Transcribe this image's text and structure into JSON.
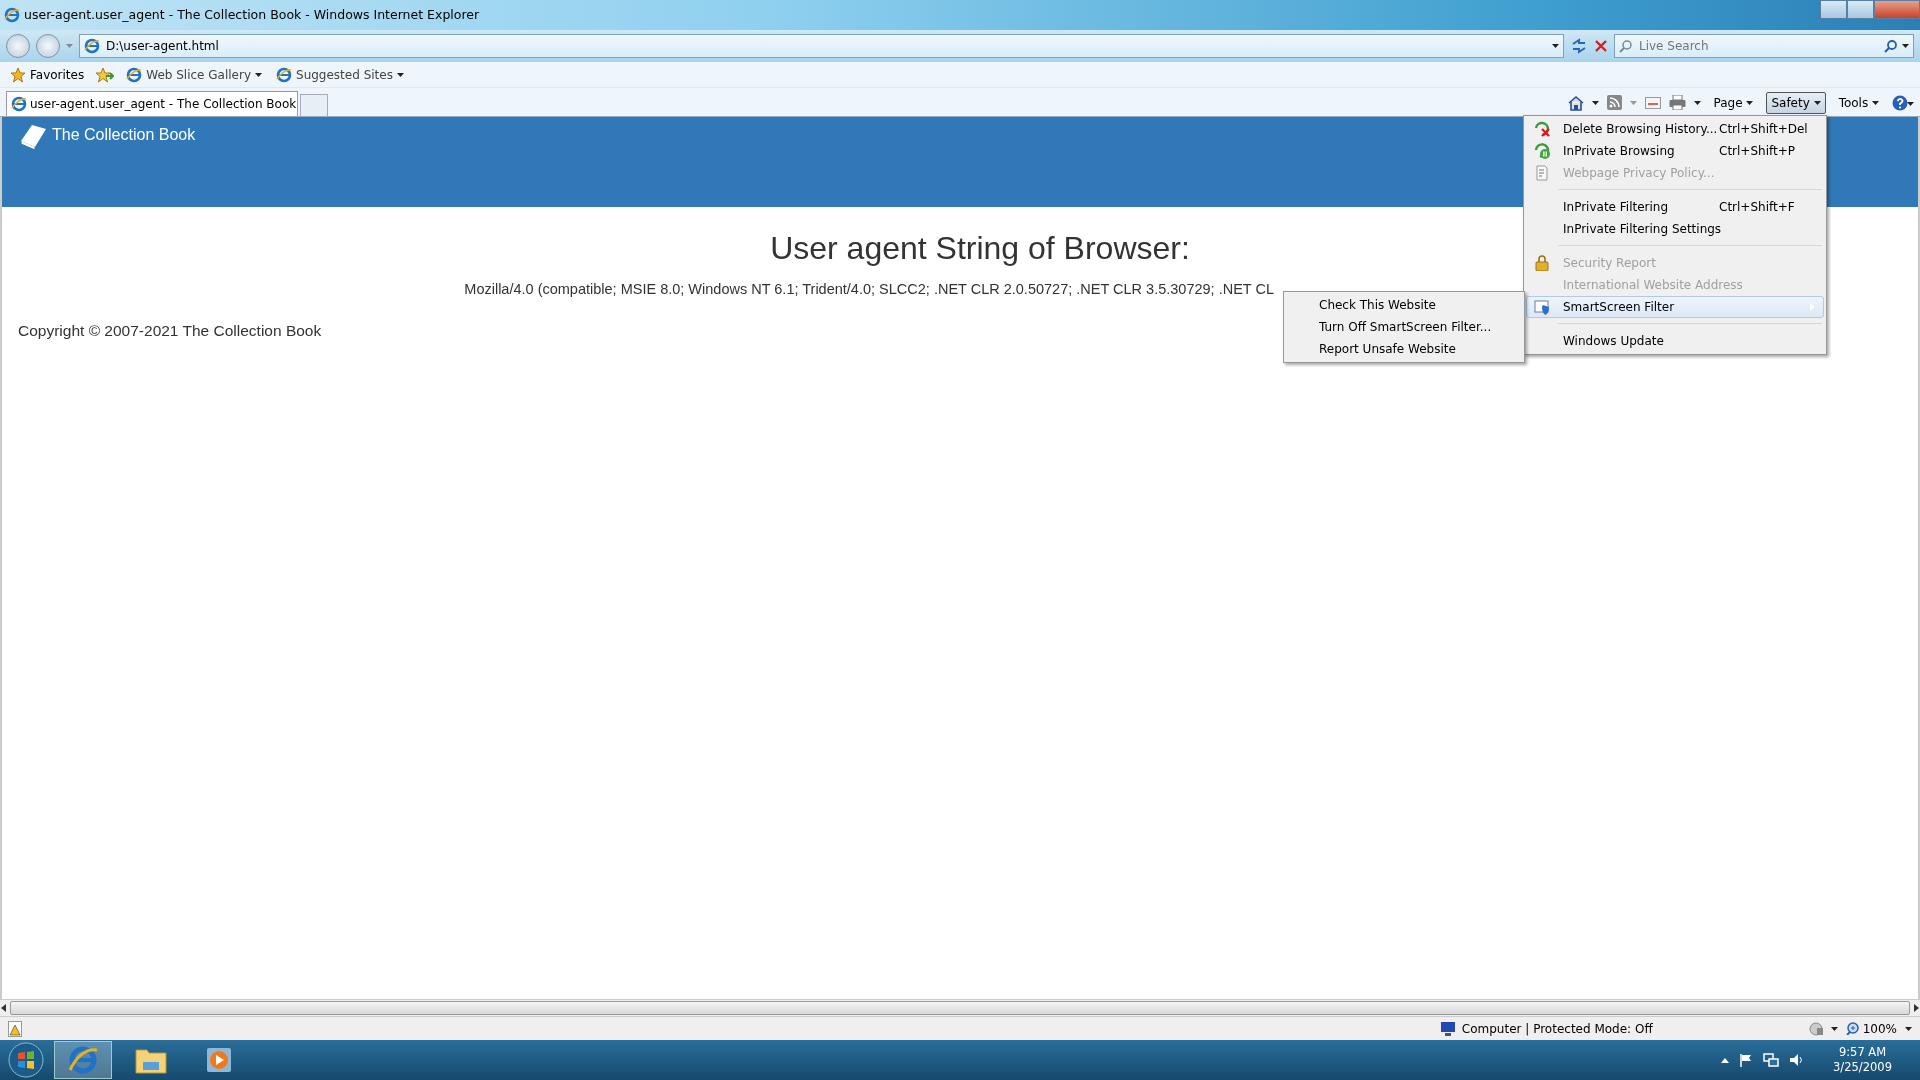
{
  "window": {
    "title": "user-agent.user_agent - The Collection Book - Windows Internet Explorer"
  },
  "address_bar": {
    "value": "D:\\user-agent.html"
  },
  "search": {
    "placeholder": "Live Search"
  },
  "favorites_bar": [
    {
      "label": "Favorites",
      "kind": "favorites"
    },
    {
      "label": "Web Slice Gallery",
      "kind": "dropdown"
    },
    {
      "label": "Suggested Sites",
      "kind": "dropdown"
    }
  ],
  "tabs": [
    {
      "label": "user-agent.user_agent - The Collection Book",
      "selected": true
    }
  ],
  "command_bar": [
    {
      "label": "Page",
      "selected": false
    },
    {
      "label": "Safety",
      "selected": true
    },
    {
      "label": "Tools",
      "selected": false
    }
  ],
  "page": {
    "brand": "The Collection Book",
    "heading": "User agent String of Browser:",
    "user_agent": "Mozilla/4.0 (compatible; MSIE 8.0; Windows NT 6.1; Trident/4.0; SLCC2; .NET CLR 2.0.50727; .NET CLR 3.5.30729; .NET CL",
    "copyright": "Copyright © 2007-2021 The Collection Book"
  },
  "safety_menu": [
    {
      "kind": "item",
      "label": "Delete Browsing History...",
      "shortcut": "Ctrl+Shift+Del",
      "disabled": false,
      "selected": false
    },
    {
      "kind": "item",
      "label": "InPrivate Browsing",
      "shortcut": "Ctrl+Shift+P",
      "disabled": false,
      "selected": false
    },
    {
      "kind": "item",
      "label": "Webpage Privacy Policy...",
      "disabled": true,
      "selected": false
    },
    {
      "kind": "separator"
    },
    {
      "kind": "item",
      "label": "InPrivate Filtering",
      "shortcut": "Ctrl+Shift+F",
      "disabled": false,
      "selected": false
    },
    {
      "kind": "item",
      "label": "InPrivate Filtering Settings",
      "disabled": false,
      "selected": false
    },
    {
      "kind": "separator"
    },
    {
      "kind": "item",
      "label": "Security Report",
      "disabled": true,
      "selected": false
    },
    {
      "kind": "item",
      "label": "International Website Address",
      "disabled": true,
      "selected": false
    },
    {
      "kind": "submenu",
      "label": "SmartScreen Filter",
      "disabled": false,
      "selected": true
    },
    {
      "kind": "separator"
    },
    {
      "kind": "item",
      "label": "Windows Update",
      "disabled": false,
      "selected": false
    }
  ],
  "smartscreen_submenu": [
    {
      "label": "Check This Website"
    },
    {
      "label": "Turn Off SmartScreen Filter..."
    },
    {
      "label": "Report Unsafe Website"
    }
  ],
  "status_bar": {
    "zone": "Computer | Protected Mode: Off",
    "zoom": "100%"
  },
  "taskbar": {
    "time": "9:57 AM",
    "date": "3/25/2009"
  }
}
